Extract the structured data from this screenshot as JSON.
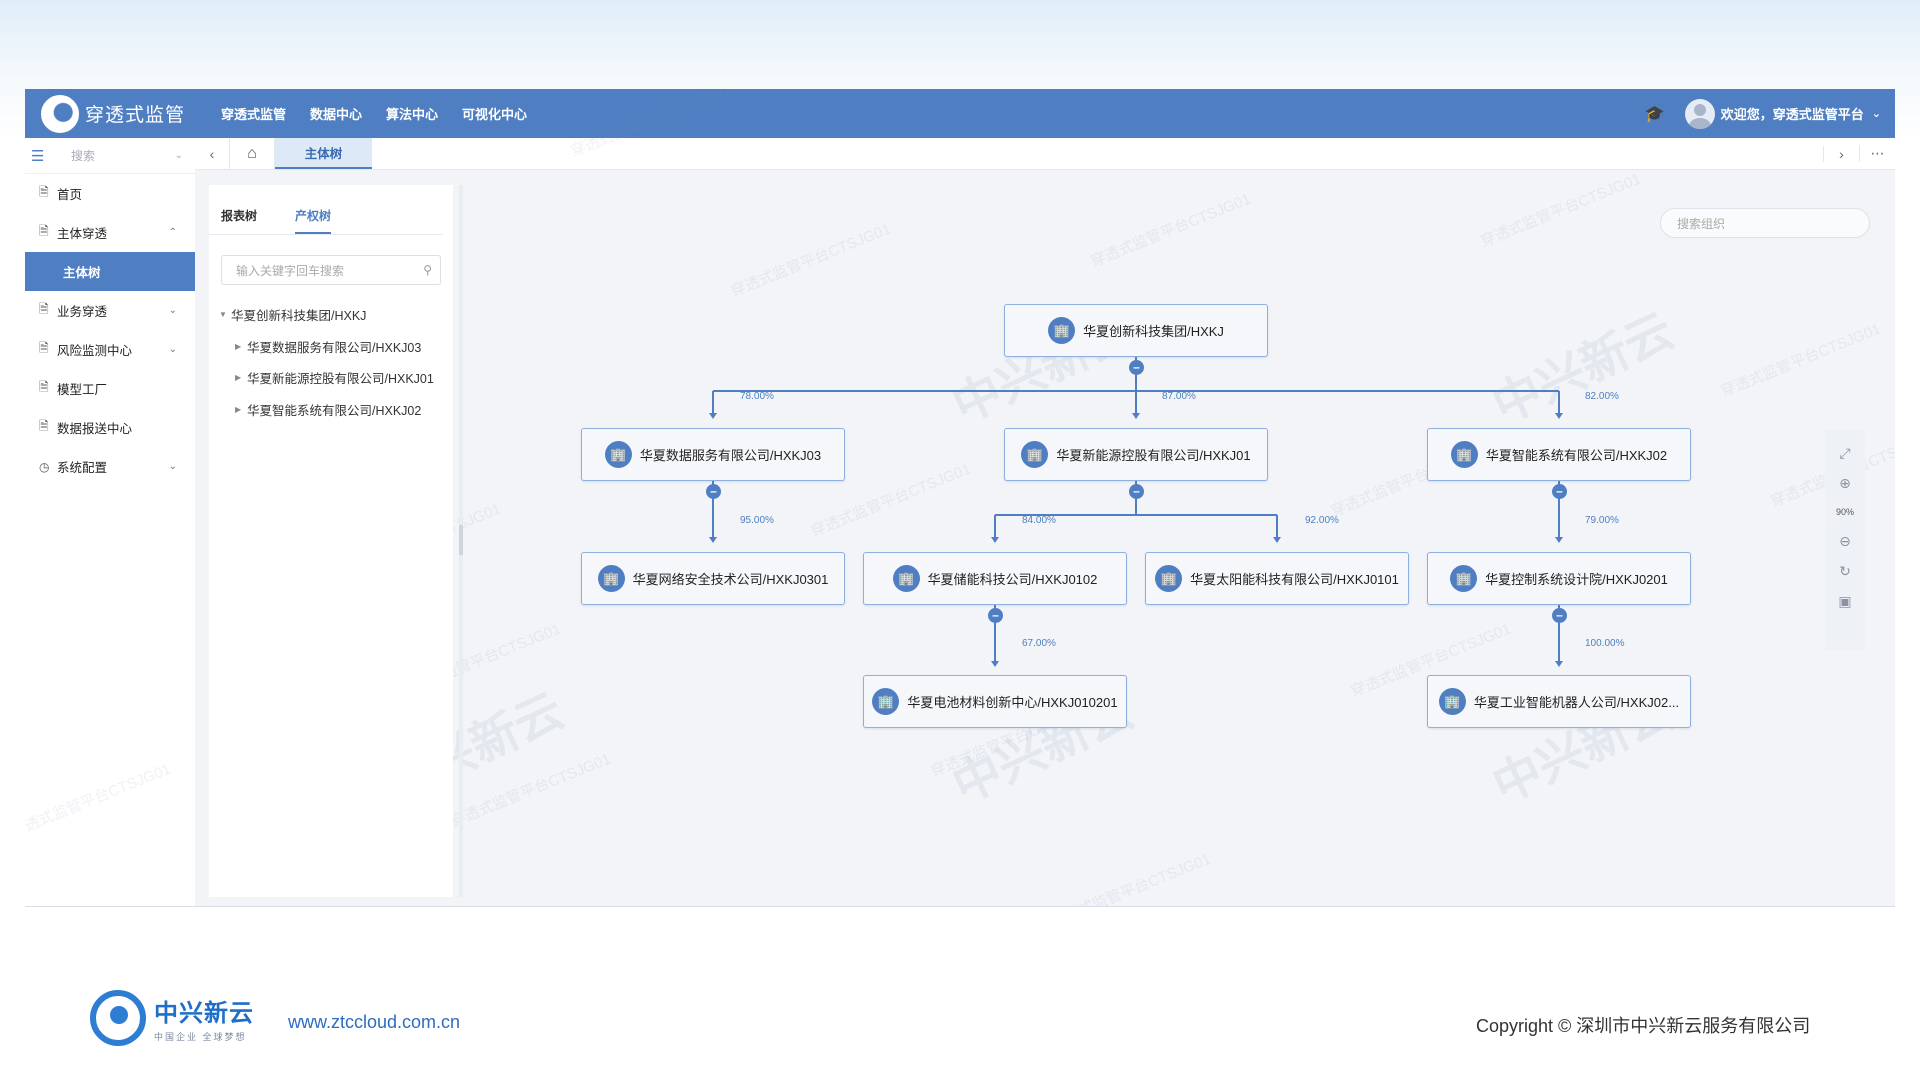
{
  "app": {
    "logo_text": "穿透式监管",
    "nav": [
      "穿透式监管",
      "数据中心",
      "算法中心",
      "可视化中心"
    ],
    "user_greeting": "欢迎您，穿透式监管平台"
  },
  "sidebar": {
    "search_placeholder": "搜索",
    "items": [
      {
        "label": "首页",
        "icon": "doc-icon"
      },
      {
        "label": "主体穿透",
        "icon": "doc-icon"
      },
      {
        "label": "主体树",
        "icon": ""
      },
      {
        "label": "业务穿透",
        "icon": "doc-icon"
      },
      {
        "label": "风险监测中心",
        "icon": "doc-icon"
      },
      {
        "label": "模型工厂",
        "icon": "doc-icon"
      },
      {
        "label": "数据报送中心",
        "icon": "doc-icon"
      },
      {
        "label": "系统配置",
        "icon": "clock-icon"
      }
    ]
  },
  "tabs": {
    "active": "主体树"
  },
  "tree_panel": {
    "tabs": [
      "报表树",
      "产权树"
    ],
    "active_tab": "产权树",
    "search_placeholder": "输入关键字回车搜索",
    "root": "华夏创新科技集团/HXKJ",
    "children": [
      "华夏数据服务有限公司/HXKJ03",
      "华夏新能源控股有限公司/HXKJ01",
      "华夏智能系统有限公司/HXKJ02"
    ]
  },
  "chart": {
    "search_placeholder": "搜索组织",
    "zoom": "90%",
    "nodes": {
      "root": "华夏创新科技集团/HXKJ",
      "n03": "华夏数据服务有限公司/HXKJ03",
      "n01": "华夏新能源控股有限公司/HXKJ01",
      "n02": "华夏智能系统有限公司/HXKJ02",
      "n0301": "华夏网络安全技术公司/HXKJ0301",
      "n0102": "华夏储能科技公司/HXKJ0102",
      "n0101": "华夏太阳能科技有限公司/HXKJ0101",
      "n0201": "华夏控制系统设计院/HXKJ0201",
      "n010201": "华夏电池材料创新中心/HXKJ010201",
      "n020x": "华夏工业智能机器人公司/HXKJ02..."
    },
    "percents": {
      "p03": "78.00%",
      "p01": "87.00%",
      "p02": "82.00%",
      "p0301": "95.00%",
      "p0102": "84.00%",
      "p0101": "92.00%",
      "p0201": "79.00%",
      "p010201": "67.00%",
      "p020x": "100.00%"
    }
  },
  "watermark": {
    "text": "穿透式监管平台CTSJG01",
    "brand": "中兴新云"
  },
  "footer": {
    "brand": "中兴新云",
    "slogan": "中国企业 全球梦想",
    "url": "www.ztccloud.com.cn",
    "copyright": "Copyright © 深圳市中兴新云服务有限公司"
  }
}
